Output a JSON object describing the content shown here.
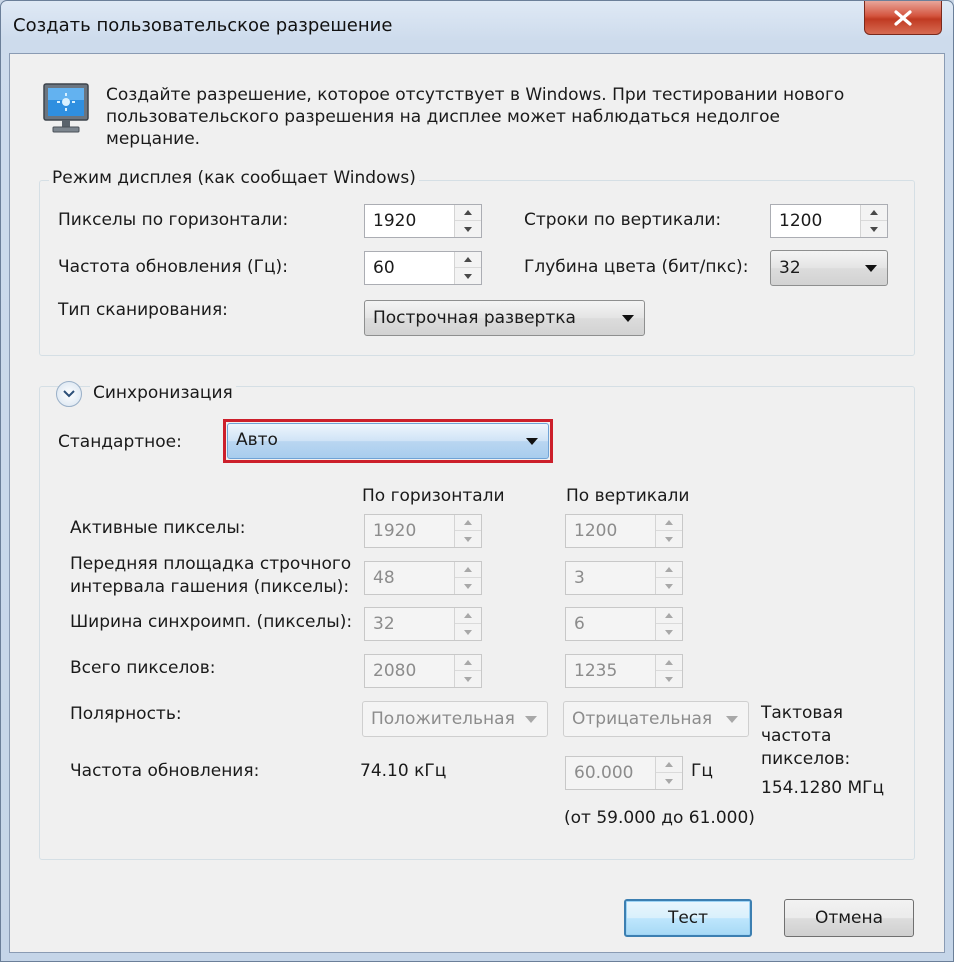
{
  "window": {
    "title": "Создать пользовательское разрешение"
  },
  "description": "Создайте разрешение, которое отсутствует в Windows. При тестировании нового пользовательского разрешения на дисплее может наблюдаться недолгое мерцание.",
  "display_mode": {
    "group_label": "Режим дисплея (как сообщает Windows)",
    "h_pixels_label": "Пикселы по горизонтали:",
    "h_pixels_value": "1920",
    "v_lines_label": "Строки по вертикали:",
    "v_lines_value": "1200",
    "refresh_label": "Частота обновления (Гц):",
    "refresh_value": "60",
    "color_depth_label": "Глубина цвета (бит/пкс):",
    "color_depth_value": "32",
    "scan_type_label": "Тип сканирования:",
    "scan_type_value": "Построчная развертка"
  },
  "sync": {
    "group_label": "Синхронизация",
    "standard_label": "Стандартное:",
    "standard_value": "Авто",
    "col_horizontal": "По горизонтали",
    "col_vertical": "По вертикали",
    "rows": [
      {
        "label": "Активные пикселы:",
        "h": "1920",
        "v": "1200"
      },
      {
        "label": "Передняя площадка строчного интервала гашения (пикселы):",
        "label_line1": "Передняя площадка строчного",
        "label_line2": "интервала гашения (пикселы):",
        "h": "48",
        "v": "3"
      },
      {
        "label": "Ширина синхроимп. (пикселы):",
        "h": "32",
        "v": "6"
      },
      {
        "label": "Всего пикселов:",
        "h": "2080",
        "v": "1235"
      }
    ],
    "polarity_label": "Полярность:",
    "polarity_h": "Положительная",
    "polarity_v": "Отрицательная",
    "refresh_label": "Частота обновления:",
    "refresh_h": "74.10 кГц",
    "refresh_v": "60.000",
    "refresh_unit": "Гц",
    "refresh_range": "(от 59.000 до 61.000)",
    "pixel_clock_line1": "Тактовая",
    "pixel_clock_line2": "частота",
    "pixel_clock_line3": "пикселов:",
    "pixel_clock_value": "154.1280 МГц"
  },
  "buttons": {
    "test": "Тест",
    "cancel": "Отмена"
  },
  "colors": {
    "highlight": "#cc1f2b",
    "close_button": "#c03a22",
    "default_button": "#3c7fb1"
  },
  "icons": {
    "monitor": "monitor-icon",
    "close": "close-icon",
    "expand": "chevron-down-icon"
  }
}
